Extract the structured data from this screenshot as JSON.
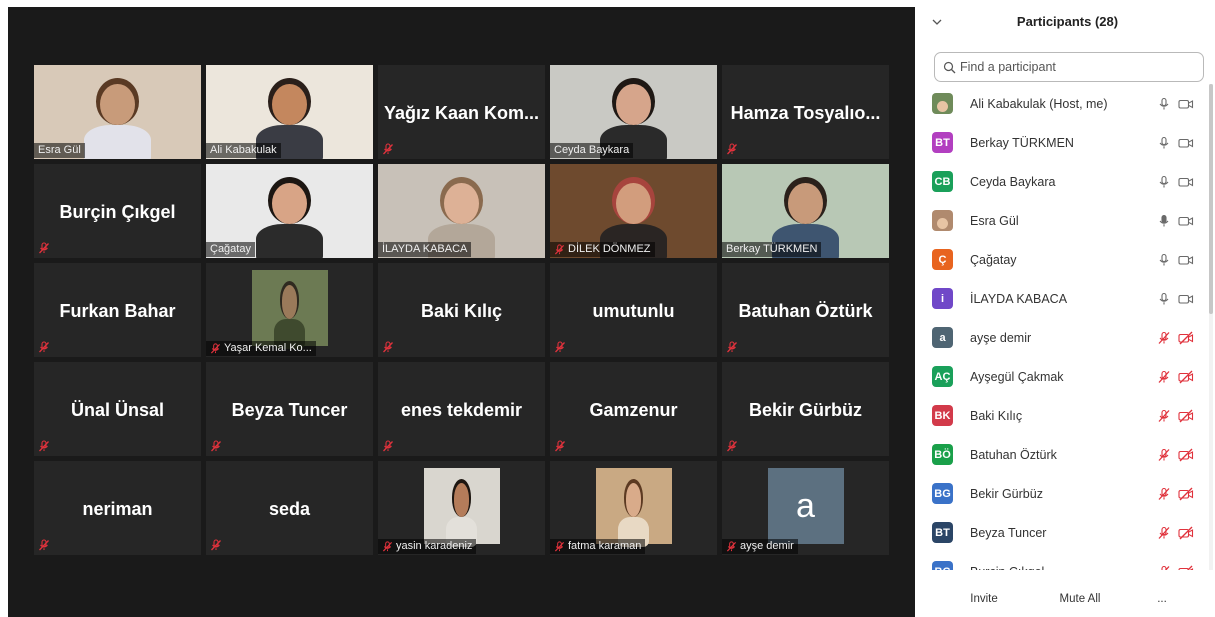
{
  "meeting": {
    "tiles": [
      {
        "kind": "video",
        "label": "Esra Gül",
        "active": true,
        "photo": {
          "bg": "#d8c9b8",
          "head": "#c89b7a",
          "body": "#e2e2ea",
          "hair": "#5a3a24"
        }
      },
      {
        "kind": "video",
        "label": "Ali Kabakulak",
        "photo": {
          "bg": "#ece6dc",
          "head": "#c4875e",
          "body": "#3a3c44",
          "hair": "#2a1f1a"
        }
      },
      {
        "kind": "name",
        "name": "Yağız Kaan Kom...",
        "muted": true
      },
      {
        "kind": "video",
        "label": "Ceyda Baykara",
        "photo": {
          "bg": "#c9c9c4",
          "head": "#d6a58b",
          "body": "#2a2a2a",
          "hair": "#1f1814"
        }
      },
      {
        "kind": "name",
        "name": "Hamza Tosyalıo...",
        "muted": true
      },
      {
        "kind": "name",
        "name": "Burçin Çıkgel",
        "muted": true
      },
      {
        "kind": "video",
        "label": "Çağatay",
        "photo": {
          "bg": "#e9e9e9",
          "head": "#d8a486",
          "body": "#2b2b2b",
          "hair": "#1c1612"
        }
      },
      {
        "kind": "video",
        "label": "İLAYDA KABACA",
        "photo": {
          "bg": "#c8c1b8",
          "head": "#ddb196",
          "body": "#b3a799",
          "hair": "#8a6a4e"
        }
      },
      {
        "kind": "video",
        "label": "DİLEK DÖNMEZ",
        "muted": true,
        "photo": {
          "bg": "#6e4a2e",
          "head": "#d29d7d",
          "body": "#2a2523",
          "hair": "#a7443d"
        }
      },
      {
        "kind": "video",
        "label": "Berkay TÜRKMEN",
        "photo": {
          "bg": "#b8c8b5",
          "head": "#c89a7a",
          "body": "#3e5570",
          "hair": "#2b211b"
        }
      },
      {
        "kind": "name",
        "name": "Furkan Bahar",
        "muted": true
      },
      {
        "kind": "thumb",
        "label": "Yaşar Kemal Ko...",
        "muted": true,
        "photo": {
          "bg": "#6c7a53",
          "head": "#9a7a5a",
          "body": "#3f4a2e",
          "hair": "#2f2a20"
        }
      },
      {
        "kind": "name",
        "name": "Baki Kılıç",
        "muted": true
      },
      {
        "kind": "name",
        "name": "umutunlu",
        "muted": true
      },
      {
        "kind": "name",
        "name": "Batuhan Öztürk",
        "muted": true
      },
      {
        "kind": "name",
        "name": "Ünal Ünsal",
        "muted": true
      },
      {
        "kind": "name",
        "name": "Beyza Tuncer",
        "muted": true
      },
      {
        "kind": "name",
        "name": "enes tekdemir",
        "muted": true
      },
      {
        "kind": "name",
        "name": "Gamzenur",
        "muted": true
      },
      {
        "kind": "name",
        "name": "Bekir Gürbüz",
        "muted": true
      },
      {
        "kind": "name",
        "name": "neriman",
        "muted": true
      },
      {
        "kind": "name",
        "name": "seda",
        "muted": true
      },
      {
        "kind": "thumb",
        "label": "yasin karadeniz",
        "muted": true,
        "photo": {
          "bg": "#d9d6cf",
          "head": "#b47c5a",
          "body": "#e3e0da",
          "hair": "#1d1611"
        }
      },
      {
        "kind": "thumb",
        "label": "fatma karaman",
        "muted": true,
        "photo": {
          "bg": "#c9a983",
          "head": "#d9ab8a",
          "body": "#e8d9c4",
          "hair": "#5c3a22"
        }
      },
      {
        "kind": "letter",
        "letter": "a",
        "label": "ayşe demir",
        "muted": true
      }
    ]
  },
  "participants": {
    "title": "Participants (28)",
    "search_placeholder": "Find a participant",
    "items": [
      {
        "name": "Ali Kabakulak (Host, me)",
        "avatar_photo": true,
        "avatar_color": "#6f8b5a",
        "mic": "on",
        "cam": "on"
      },
      {
        "name": "Berkay TÜRKMEN",
        "avatar": "BT",
        "avatar_color": "#b23fc0",
        "mic": "on",
        "cam": "on"
      },
      {
        "name": "Ceyda Baykara",
        "avatar": "CB",
        "avatar_color": "#1aa05a",
        "mic": "on",
        "cam": "on"
      },
      {
        "name": "Esra Gül",
        "avatar_photo": true,
        "avatar_color": "#b08a6e",
        "mic": "speaking",
        "cam": "on"
      },
      {
        "name": "Çağatay",
        "avatar": "Ç",
        "avatar_color": "#e8641f",
        "mic": "on",
        "cam": "on"
      },
      {
        "name": "İLAYDA KABACA",
        "avatar": "i",
        "avatar_color": "#7048c8",
        "mic": "on",
        "cam": "on"
      },
      {
        "name": "ayşe demir",
        "avatar": "a",
        "avatar_color": "#4f6573",
        "mic": "off",
        "cam": "off"
      },
      {
        "name": "Ayşegül Çakmak",
        "avatar": "AÇ",
        "avatar_color": "#1aa05a",
        "mic": "off",
        "cam": "off"
      },
      {
        "name": "Baki Kılıç",
        "avatar": "BK",
        "avatar_color": "#d23a4a",
        "mic": "off",
        "cam": "off"
      },
      {
        "name": "Batuhan Öztürk",
        "avatar": "BÖ",
        "avatar_color": "#1aa04a",
        "mic": "off",
        "cam": "off"
      },
      {
        "name": "Bekir Gürbüz",
        "avatar": "BG",
        "avatar_color": "#3a72c8",
        "mic": "off",
        "cam": "off"
      },
      {
        "name": "Beyza Tuncer",
        "avatar": "BT",
        "avatar_color": "#2b4566",
        "mic": "off",
        "cam": "off"
      },
      {
        "name": "Burçin Çıkgel",
        "avatar": "BÇ",
        "avatar_color": "#3a72c8",
        "mic": "off",
        "cam": "off"
      }
    ]
  },
  "footer": {
    "invite": "Invite",
    "mute_all": "Mute All",
    "more": "..."
  },
  "colors": {
    "stage_bg": "#1a1a1a",
    "tile_bg": "#262626",
    "active_speaker": "#d4ec6a",
    "muted_red": "#e0323c"
  },
  "icons": [
    "chevron-down-icon",
    "search-icon",
    "mic-icon",
    "mic-muted-icon",
    "video-camera-icon",
    "video-off-icon"
  ]
}
